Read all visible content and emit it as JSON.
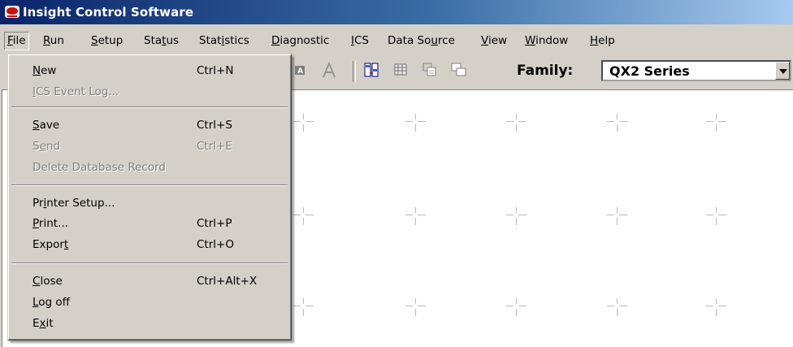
{
  "window": {
    "title": "Insight Control Software"
  },
  "menu": [
    {
      "label": "File",
      "u": "F",
      "rest": "ile",
      "pre": ""
    },
    {
      "label": "Run",
      "pre": "",
      "u": "R",
      "rest": "un"
    },
    {
      "label": "Setup",
      "pre": "",
      "u": "S",
      "rest": "etup"
    },
    {
      "label": "Status",
      "pre": "Sta",
      "u": "t",
      "rest": "us"
    },
    {
      "label": "Statistics",
      "pre": "Stat",
      "u": "i",
      "rest": "stics"
    },
    {
      "label": "Diagnostic",
      "pre": "",
      "u": "D",
      "rest": "iagnostic"
    },
    {
      "label": "ICS",
      "pre": "",
      "u": "I",
      "rest": "CS"
    },
    {
      "label": "Data Source",
      "pre": "Data So",
      "u": "u",
      "rest": "rce"
    },
    {
      "label": "View",
      "pre": "",
      "u": "V",
      "rest": "iew"
    },
    {
      "label": "Window",
      "pre": "",
      "u": "W",
      "rest": "indow"
    },
    {
      "label": "Help",
      "pre": "",
      "u": "H",
      "rest": "elp"
    }
  ],
  "file_menu": [
    {
      "label": "New",
      "pre": "",
      "u": "N",
      "rest": "ew",
      "shortcut": "Ctrl+N",
      "enabled": true
    },
    {
      "label": "ICS Event Log...",
      "pre": "",
      "u": "I",
      "rest": "CS Event Log...",
      "shortcut": "",
      "enabled": false
    },
    {
      "label": "Save",
      "pre": "",
      "u": "S",
      "rest": "ave",
      "shortcut": "Ctrl+S",
      "enabled": true
    },
    {
      "label": "Send",
      "pre": "S",
      "u": "e",
      "rest": "nd",
      "shortcut": "Ctrl+E",
      "enabled": false
    },
    {
      "label": "Delete Database Record",
      "pre": "Delete Database Record",
      "u": "",
      "rest": "",
      "shortcut": "",
      "enabled": false
    },
    {
      "label": "Printer Setup...",
      "pre": "Pr",
      "u": "i",
      "rest": "nter Setup...",
      "shortcut": "",
      "enabled": true
    },
    {
      "label": "Print...",
      "pre": "",
      "u": "P",
      "rest": "rint...",
      "shortcut": "Ctrl+P",
      "enabled": true
    },
    {
      "label": "Export",
      "pre": "Expor",
      "u": "t",
      "rest": "",
      "shortcut": "Ctrl+O",
      "enabled": true
    },
    {
      "label": "Close",
      "pre": "",
      "u": "C",
      "rest": "lose",
      "shortcut": "Ctrl+Alt+X",
      "enabled": true
    },
    {
      "label": "Log off",
      "pre": "",
      "u": "L",
      "rest": "og off",
      "shortcut": "",
      "enabled": true
    },
    {
      "label": "Exit",
      "pre": "E",
      "u": "x",
      "rest": "it",
      "shortcut": "",
      "enabled": true
    }
  ],
  "toolbar": {
    "family_label": "Family:",
    "family_value": "QX2 Series",
    "icons": [
      "font-box-icon",
      "font-a-icon",
      "transfer-icon",
      "grid-icon",
      "chart-icon",
      "windows-icon"
    ]
  }
}
